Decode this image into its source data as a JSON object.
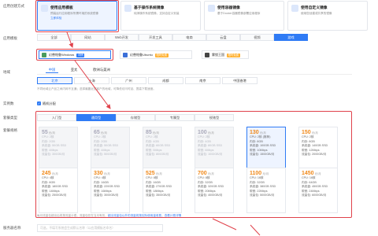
{
  "labels": {
    "create_method": "应用创建方式",
    "app_template": "应用模板",
    "region": "地域",
    "instance": "实例数",
    "package_type": "套餐类型",
    "package_spec": "套餐规格",
    "server_name": "服务器名称"
  },
  "methods": [
    {
      "title": "使用应用模板",
      "desc": "预装运行应用程序所需环境的系统镜像",
      "link": "立即体验"
    },
    {
      "title": "基于操作系统镜像",
      "desc": "纯净操作系统镜像，支持自定义安装",
      "link": ""
    },
    {
      "title": "使用容器镜像",
      "desc": "基于Docker容器镜像部署应用程序",
      "link": ""
    },
    {
      "title": "使用自定义镜像",
      "desc": "使用您创建或共享的镜像",
      "link": ""
    }
  ],
  "categories": [
    "全部",
    "网站",
    "Web开发",
    "开发工具",
    "电商",
    "云盘",
    "视频",
    "游戏"
  ],
  "apps": [
    {
      "name": "幻兽帕鲁Windows",
      "badge": "限时免费",
      "tag": "详情",
      "color": "#4a9b5f"
    },
    {
      "name": "幻兽帕鲁Ubuntu",
      "badge": "限时免费",
      "color": "#3b6fd8"
    },
    {
      "name": "雾锁王国",
      "badge": "限时免费",
      "color": "#444"
    }
  ],
  "region_tabs": [
    "中国",
    "亚太",
    "欧洲与美洲"
  ],
  "cities": [
    "北京",
    "上海",
    "广州",
    "成都",
    "南京",
    "中国香港"
  ],
  "region_note": "不同地域云产品之间内网不互通；选择最靠近您客户的地域，可降低访问时延、提高下载速度。",
  "instance_check": "✓",
  "instance_label": "随机分配",
  "package_tabs": [
    "入门型",
    "通用型",
    "存储型",
    "专属型",
    "锐驰型"
  ],
  "price_unit": "元/月",
  "specs_row1": [
    {
      "price": "55",
      "cpu": "CPU: 2核",
      "mem": "内存: 2GB",
      "disk": "系统盘: 50GB SSD",
      "bw": "带宽: 4Mbps",
      "flow": "流量包: 300GB/月"
    },
    {
      "price": "65",
      "cpu": "CPU: 2核",
      "mem": "内存: 2GB",
      "disk": "系统盘: 50GB SSD",
      "bw": "带宽: 4Mbps",
      "flow": "流量包: 500GB/月"
    },
    {
      "price": "85",
      "cpu": "CPU: 2核",
      "mem": "内存: 4GB",
      "disk": "系统盘: 60GB SSD",
      "bw": "带宽: 5Mbps",
      "flow": "流量包: 800GB/月"
    },
    {
      "price": "100",
      "cpu": "CPU: 2核",
      "mem": "内存: 4GB",
      "disk": "系统盘: 80GB SSD",
      "bw": "带宽: 6Mbps",
      "flow": "流量包: 1000GB/月"
    },
    {
      "price": "130",
      "cpu": "CPU: 2核 (推荐)",
      "mem": "内存: 8GB",
      "disk": "系统盘: 100GB SSD",
      "bw": "带宽: 10Mbps",
      "flow": "流量包: 1500GB/月"
    },
    {
      "price": "150",
      "cpu": "CPU: 2核",
      "mem": "内存: 8GB",
      "disk": "系统盘: 140GB SSD",
      "bw": "带宽: 12Mbps",
      "flow": "流量包: 2000GB/月"
    }
  ],
  "specs_row2": [
    {
      "price": "245",
      "cpu": "CPU: 4核",
      "mem": "内存: 8GB",
      "disk": "系统盘: 180GB SSD",
      "bw": "带宽: 14Mbps",
      "flow": "流量包: 2500GB/月"
    },
    {
      "price": "330",
      "cpu": "CPU: 4核",
      "mem": "内存: 16GB",
      "disk": "系统盘: 220GB SSD",
      "bw": "带宽: 16Mbps",
      "flow": "流量包: 3000GB/月"
    },
    {
      "price": "525",
      "cpu": "CPU: 8核",
      "mem": "内存: 16GB",
      "disk": "系统盘: 270GB SSD",
      "bw": "带宽: 18Mbps",
      "flow": "流量包: 3500GB/月"
    },
    {
      "price": "700",
      "cpu": "CPU: 8核",
      "mem": "内存: 32GB",
      "disk": "系统盘: 320GB SSD",
      "bw": "带宽: 20Mbps",
      "flow": "流量包: 4000GB/月"
    },
    {
      "price": "1100",
      "cpu": "CPU: 16核",
      "mem": "内存: 32GB",
      "disk": "系统盘: 380GB SSD",
      "bw": "带宽: 22Mbps",
      "flow": "流量包: 5000GB/月"
    },
    {
      "price": "1450",
      "cpu": "CPU: 16核",
      "mem": "内存: 64GB",
      "disk": "系统盘: 450GB SSD",
      "bw": "带宽: 24Mbps",
      "flow": "流量包: 6000GB/月"
    }
  ],
  "footer_note": "每月流量包超出后将按流量计费，流量包仅在当月有效，",
  "footer_link": "超出流量包以外的流量将按实际使用量收费，查看计费详情",
  "name_placeholder": "可选，不填写系统会生成默认名称（以应用模板名命名）",
  "colors": {
    "accent": "#2f7bf5",
    "highlight": "#e0424b",
    "price": "#f08a1c"
  }
}
